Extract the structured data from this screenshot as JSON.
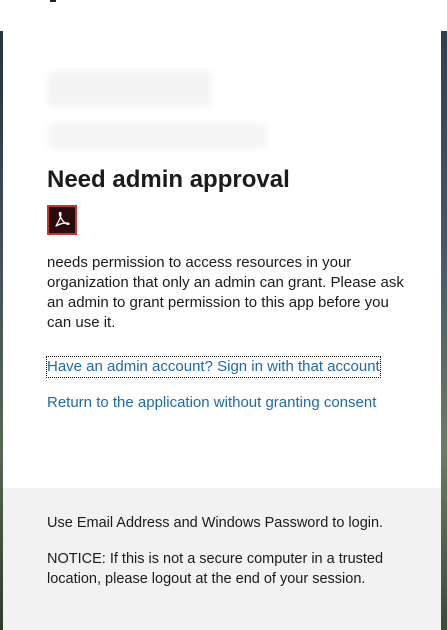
{
  "dialog": {
    "title": "Need admin approval",
    "app_icon": "acrobat-icon",
    "description": "needs permission to access resources in your organization that only an admin can grant. Please ask an admin to grant permission to this app before you can use it.",
    "signin_link": "Have an admin account? Sign in with that account",
    "return_link": "Return to the application without granting consent"
  },
  "footer": {
    "login_hint": "Use Email Address and Windows Password to login.",
    "notice": "NOTICE: If this is not a secure computer in a trusted location, please logout at the end of your session."
  },
  "colors": {
    "link": "#1f6aa5",
    "text": "#1b1b1b",
    "footer_bg": "#f2f2f2",
    "icon_border": "#c0392b"
  }
}
